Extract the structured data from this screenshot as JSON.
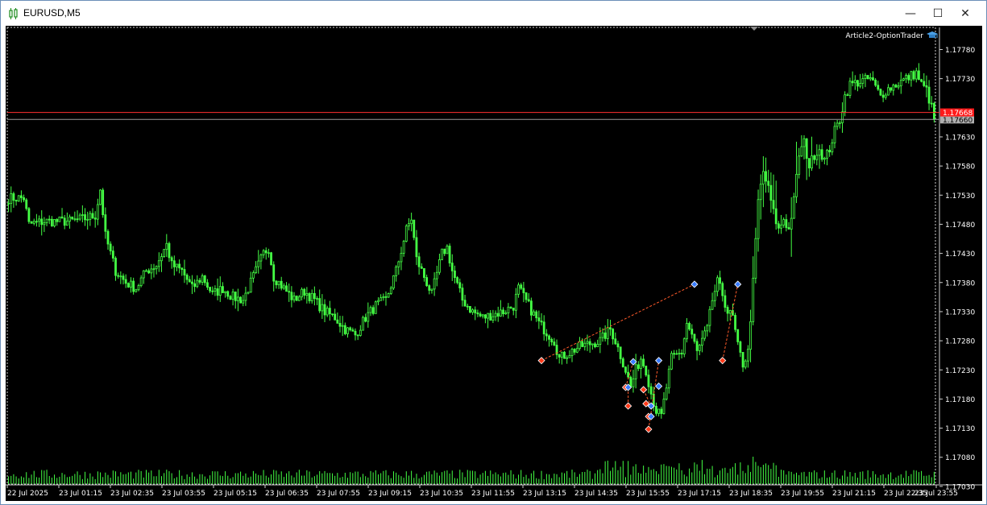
{
  "window": {
    "title": "EURUSD,M5",
    "minimize_glyph": "—",
    "maximize_glyph": "☐",
    "close_glyph": "✕"
  },
  "expert_label": "Article2-OptionTrader",
  "chart_data": {
    "type": "candlestick",
    "symbol": "EURUSD",
    "timeframe": "M5",
    "candle_color": "#44ff44",
    "background": "#000000",
    "grid": false,
    "ylim": [
      1.17034,
      1.17818
    ],
    "y_ticks": [
      "1.17780",
      "1.17730",
      "1.17630",
      "1.17580",
      "1.17530",
      "1.17480",
      "1.17430",
      "1.17380",
      "1.17330",
      "1.17280",
      "1.17230",
      "1.17180",
      "1.17130",
      "1.17080",
      "1.17030"
    ],
    "price_labels": [
      {
        "text": "1.17660",
        "price": 1.1766,
        "color": "#b0b0b0",
        "line_color": "#9a9a9a"
      },
      {
        "text": "1.17668",
        "price": 1.17672,
        "color": "#ff1a1a",
        "line_color": "#ff3030"
      }
    ],
    "x_labels": [
      "22 Jul 2025",
      "23 Jul 01:15",
      "23 Jul 02:35",
      "23 Jul 03:55",
      "23 Jul 05:15",
      "23 Jul 06:35",
      "23 Jul 07:55",
      "23 Jul 09:15",
      "23 Jul 10:35",
      "23 Jul 11:55",
      "23 Jul 13:15",
      "23 Jul 14:35",
      "23 Jul 15:55",
      "23 Jul 17:15",
      "23 Jul 18:35",
      "23 Jul 19:55",
      "23 Jul 21:15",
      "23 Jul 22:35",
      "23 Jul 23:55"
    ],
    "close_path": [
      [
        0,
        1.17525
      ],
      [
        6,
        1.17525
      ],
      [
        8,
        1.1748
      ],
      [
        14,
        1.17485
      ],
      [
        24,
        1.17485
      ],
      [
        30,
        1.1749
      ],
      [
        34,
        1.17495
      ],
      [
        36,
        1.1754
      ],
      [
        38,
        1.1746
      ],
      [
        42,
        1.174
      ],
      [
        46,
        1.1738
      ],
      [
        50,
        1.1737
      ],
      [
        54,
        1.174
      ],
      [
        58,
        1.1741
      ],
      [
        62,
        1.17445
      ],
      [
        64,
        1.1741
      ],
      [
        68,
        1.174
      ],
      [
        72,
        1.1737
      ],
      [
        76,
        1.1739
      ],
      [
        80,
        1.1736
      ],
      [
        84,
        1.1737
      ],
      [
        88,
        1.17355
      ],
      [
        92,
        1.1735
      ],
      [
        96,
        1.1739
      ],
      [
        100,
        1.1743
      ],
      [
        102,
        1.1744
      ],
      [
        104,
        1.1739
      ],
      [
        108,
        1.1737
      ],
      [
        112,
        1.1735
      ],
      [
        116,
        1.17365
      ],
      [
        120,
        1.1735
      ],
      [
        124,
        1.1733
      ],
      [
        128,
        1.1732
      ],
      [
        132,
        1.173
      ],
      [
        136,
        1.1729
      ],
      [
        140,
        1.1732
      ],
      [
        144,
        1.1734
      ],
      [
        148,
        1.1735
      ],
      [
        152,
        1.174
      ],
      [
        156,
        1.1747
      ],
      [
        158,
        1.1749
      ],
      [
        160,
        1.1742
      ],
      [
        164,
        1.1738
      ],
      [
        166,
        1.1736
      ],
      [
        170,
        1.1743
      ],
      [
        172,
        1.1744
      ],
      [
        174,
        1.174
      ],
      [
        178,
        1.1735
      ],
      [
        182,
        1.1733
      ],
      [
        186,
        1.1732
      ],
      [
        190,
        1.17325
      ],
      [
        194,
        1.1733
      ],
      [
        198,
        1.1734
      ],
      [
        200,
        1.1737
      ],
      [
        204,
        1.1734
      ],
      [
        208,
        1.1731
      ],
      [
        212,
        1.1729
      ],
      [
        214,
        1.1728
      ],
      [
        216,
        1.1725
      ],
      [
        220,
        1.1726
      ],
      [
        224,
        1.1727
      ],
      [
        228,
        1.17275
      ],
      [
        232,
        1.1728
      ],
      [
        236,
        1.173
      ],
      [
        238,
        1.1728
      ],
      [
        242,
        1.1723
      ],
      [
        244,
        1.172
      ],
      [
        246,
        1.1723
      ],
      [
        248,
        1.1725
      ],
      [
        250,
        1.1723
      ],
      [
        252,
        1.1719
      ],
      [
        254,
        1.1716
      ],
      [
        256,
        1.1715
      ],
      [
        258,
        1.172
      ],
      [
        260,
        1.1725
      ],
      [
        264,
        1.1726
      ],
      [
        266,
        1.1731
      ],
      [
        268,
        1.1729
      ],
      [
        270,
        1.1726
      ],
      [
        274,
        1.173
      ],
      [
        276,
        1.1735
      ],
      [
        278,
        1.1738
      ],
      [
        280,
        1.1736
      ],
      [
        282,
        1.1733
      ],
      [
        284,
        1.1732
      ],
      [
        286,
        1.1727
      ],
      [
        288,
        1.1724
      ],
      [
        290,
        1.1726
      ],
      [
        292,
        1.1738
      ],
      [
        294,
        1.1752
      ],
      [
        296,
        1.1757
      ],
      [
        298,
        1.1754
      ],
      [
        300,
        1.175
      ],
      [
        302,
        1.1747
      ],
      [
        304,
        1.1749
      ],
      [
        306,
        1.1747
      ],
      [
        308,
        1.1752
      ],
      [
        310,
        1.176
      ],
      [
        312,
        1.1762
      ],
      [
        314,
        1.1758
      ],
      [
        316,
        1.176
      ],
      [
        318,
        1.1761
      ],
      [
        320,
        1.1759
      ],
      [
        322,
        1.1761
      ],
      [
        324,
        1.1764
      ],
      [
        326,
        1.1766
      ],
      [
        328,
        1.177
      ],
      [
        330,
        1.1772
      ],
      [
        334,
        1.17725
      ],
      [
        338,
        1.1773
      ],
      [
        342,
        1.177
      ],
      [
        344,
        1.1771
      ],
      [
        348,
        1.1772
      ],
      [
        352,
        1.1773
      ],
      [
        356,
        1.1774
      ],
      [
        358,
        1.1772
      ],
      [
        360,
        1.1771
      ],
      [
        362,
        1.1768
      ],
      [
        363,
        1.1766
      ]
    ],
    "markers": [
      {
        "price": 1.17246,
        "bar": 209,
        "kind": "sell"
      },
      {
        "price": 1.17377,
        "bar": 269,
        "kind": "buy"
      },
      {
        "price": 1.17244,
        "bar": 245,
        "kind": "buy"
      },
      {
        "price": 1.172,
        "bar": 242,
        "kind": "sell"
      },
      {
        "price": 1.172,
        "bar": 243,
        "kind": "buy"
      },
      {
        "price": 1.17168,
        "bar": 243,
        "kind": "sell"
      },
      {
        "price": 1.17196,
        "bar": 249,
        "kind": "sell"
      },
      {
        "price": 1.17172,
        "bar": 250,
        "kind": "sell"
      },
      {
        "price": 1.1715,
        "bar": 251,
        "kind": "sell"
      },
      {
        "price": 1.17128,
        "bar": 251,
        "kind": "sell"
      },
      {
        "price": 1.17168,
        "bar": 252,
        "kind": "buy"
      },
      {
        "price": 1.1715,
        "bar": 252,
        "kind": "buy"
      },
      {
        "price": 1.17246,
        "bar": 255,
        "kind": "buy"
      },
      {
        "price": 1.17202,
        "bar": 255,
        "kind": "buy"
      },
      {
        "price": 1.17246,
        "bar": 280,
        "kind": "sell"
      },
      {
        "price": 1.17377,
        "bar": 286,
        "kind": "buy"
      }
    ]
  }
}
